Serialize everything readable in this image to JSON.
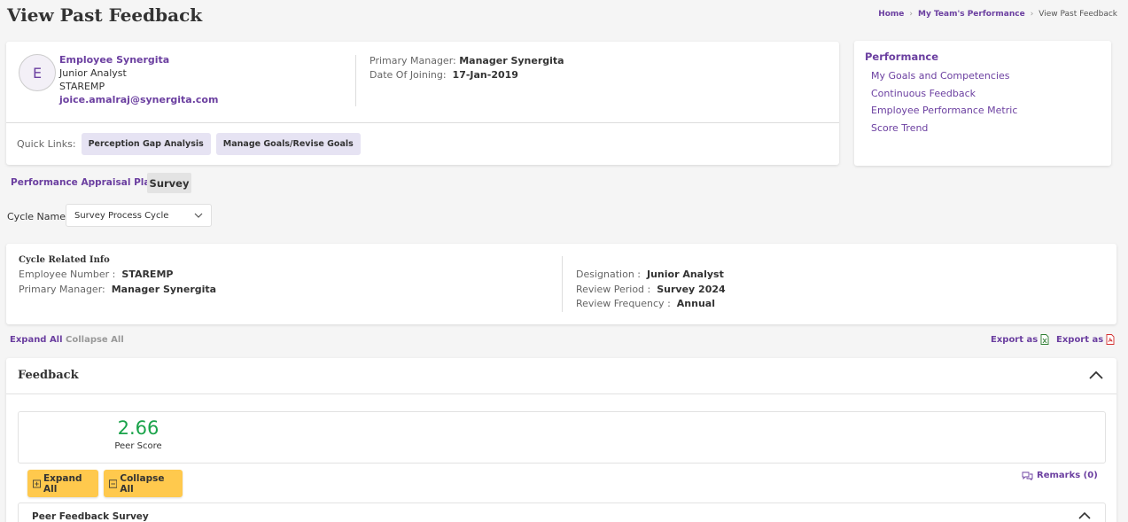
{
  "page": {
    "title": "View Past Feedback"
  },
  "breadcrumb": {
    "home": "Home",
    "team": "My Team's Performance",
    "current": "View Past Feedback"
  },
  "employee": {
    "initial": "E",
    "name": "Employee Synergita",
    "designation": "Junior Analyst",
    "code": "STAREMP",
    "email": "joice.amalraj@synergita.com",
    "primary_manager_label": "Primary Manager:",
    "primary_manager": "Manager Synergita",
    "doj_label": "Date Of Joining:",
    "doj": "17-Jan-2019"
  },
  "quick_links": {
    "label": "Quick Links:",
    "items": [
      "Perception Gap Analysis",
      "Manage Goals/Revise Goals"
    ]
  },
  "side_panel": {
    "title": "Performance",
    "links": [
      "My Goals and Competencies",
      "Continuous Feedback",
      "Employee Performance Metric",
      "Score Trend"
    ]
  },
  "tabs": {
    "pap": "Performance Appraisal Plan",
    "survey": "Survey"
  },
  "cycle": {
    "label": "Cycle Name",
    "selected": "Survey Process Cycle"
  },
  "cycle_info": {
    "title": "Cycle Related Info",
    "employee_number_label": "Employee Number :",
    "employee_number": "STAREMP",
    "primary_manager_label": "Primary Manager:",
    "primary_manager": "Manager Synergita",
    "designation_label": "Designation :",
    "designation": "Junior Analyst",
    "review_period_label": "Review Period :",
    "review_period": "Survey 2024",
    "review_frequency_label": "Review Frequency :",
    "review_frequency": "Annual"
  },
  "actions": {
    "expand_all": "Expand All",
    "collapse_all": "Collapse All",
    "export_excel": "Export as",
    "export_pdf": "Export as"
  },
  "feedback": {
    "title": "Feedback",
    "peer_score": "2.66",
    "peer_score_label": "Peer Score",
    "expand_all": "Expand All",
    "collapse_all": "Collapse All",
    "remarks": "Remarks (0)",
    "section_title": "Peer Feedback Survey"
  },
  "colors": {
    "accent": "#6b3fa0",
    "score_green": "#1aa34a",
    "button_yellow": "#ffc94d",
    "chip_bg": "#e6e3f3"
  },
  "icons": [
    "chevron-right-icon",
    "chevron-down-icon",
    "chevron-up-icon",
    "excel-file-icon",
    "pdf-file-icon",
    "plus-square-icon",
    "minus-square-icon",
    "comments-icon"
  ]
}
